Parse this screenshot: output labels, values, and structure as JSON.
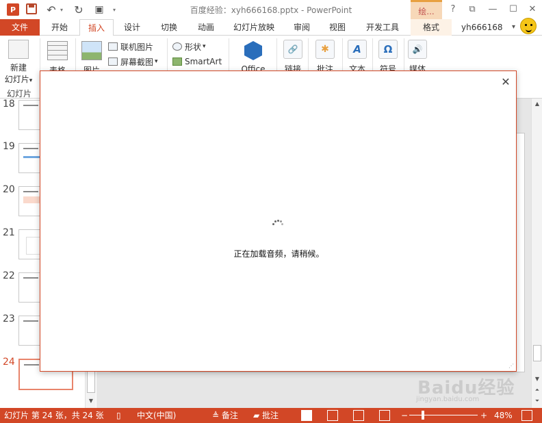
{
  "window": {
    "title": "百度经验：xyh666168.pptx - PowerPoint",
    "context_tab_head": "绘...",
    "help": "?",
    "ribbon_options": "⧉",
    "minimize": "—",
    "maximize": "☐",
    "close": "✕"
  },
  "qat": {
    "undo": "↶",
    "undo_dropdown": "▾",
    "redo": "↻",
    "present": "▣",
    "customize": "▾"
  },
  "tabs": {
    "file": "文件",
    "items": [
      "开始",
      "插入",
      "设计",
      "切换",
      "动画",
      "幻灯片放映",
      "审阅",
      "视图",
      "开发工具",
      "格式"
    ],
    "active_index": 1,
    "user": "yh666168",
    "user_dropdown": "▾"
  },
  "ribbon": {
    "new_slide": {
      "line1": "新建",
      "line2": "幻灯片",
      "dropdown": "▾"
    },
    "group_slides": "幻灯片",
    "table": "表格",
    "picture": "图片",
    "online_picture": "联机图片",
    "screenshot": "屏幕截图",
    "screenshot_dropdown": "▾",
    "shapes": "形状",
    "shapes_dropdown": "▾",
    "smartart": "SmartArt",
    "office": "Office",
    "link": "链接",
    "comment": "批注",
    "text": "文本",
    "text_glyph": "A",
    "symbol": "符号",
    "symbol_glyph": "Ω",
    "media": "媒体",
    "media_glyph": "🔊"
  },
  "slides": {
    "numbers": [
      "18",
      "19",
      "20",
      "21",
      "22",
      "23",
      "24"
    ],
    "current": "24"
  },
  "dialog": {
    "close": "✕",
    "loading_text": "正在加载音频，请稍候。",
    "grip": "⋰"
  },
  "statusbar": {
    "slide_info": "幻灯片 第 24 张，共 24 张",
    "language": "中文(中国)",
    "notes": "备注",
    "comments": "批注",
    "zoom_minus": "−",
    "zoom_plus": "+",
    "zoom": "48%",
    "zoom_level": 0.48
  },
  "watermark": {
    "text": "Baidu经验",
    "sub": "jingyan.baidu.com"
  },
  "colors": {
    "accent": "#d24726",
    "dialog_border": "#d24726"
  }
}
